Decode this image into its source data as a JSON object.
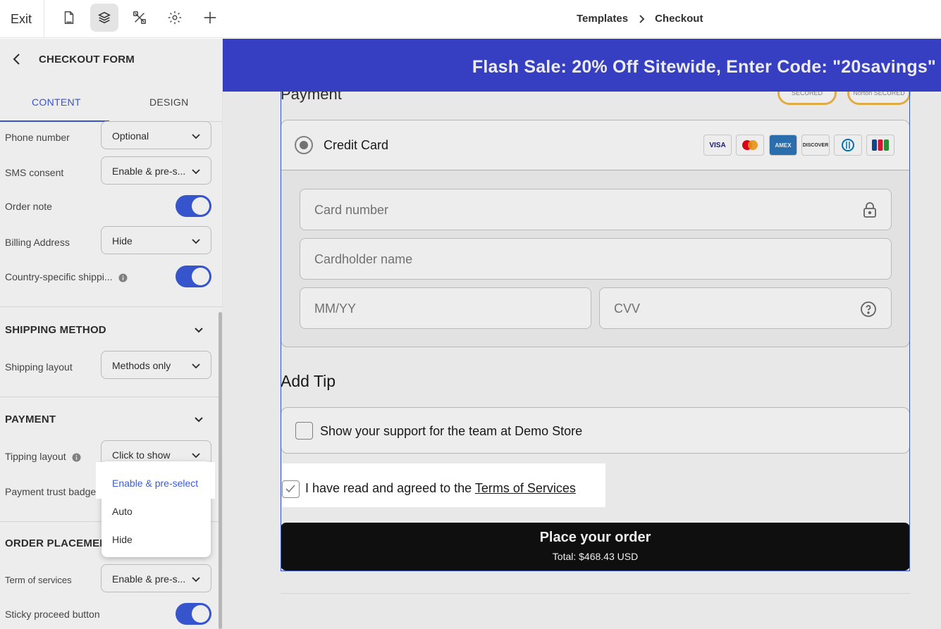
{
  "topbar": {
    "exit_label": "Exit",
    "icons": [
      "page-icon",
      "layers-icon",
      "tools-icon",
      "settings-icon",
      "add-icon"
    ],
    "breadcrumb": [
      "Templates",
      "Checkout"
    ]
  },
  "sidebar": {
    "title": "CHECKOUT FORM",
    "tabs": [
      "CONTENT",
      "DESIGN"
    ],
    "fields": {
      "phone": {
        "label": "Phone number",
        "value": "Optional"
      },
      "sms": {
        "label": "SMS consent",
        "value": "Enable & pre-s..."
      },
      "order_note": {
        "label": "Order note",
        "on": true
      },
      "billing": {
        "label": "Billing Address",
        "value": "Hide"
      },
      "country": {
        "label": "Country-specific shippi...",
        "on": true
      }
    },
    "shipping": {
      "title": "SHIPPING METHOD",
      "layout_label": "Shipping layout",
      "layout_value": "Methods only"
    },
    "payment": {
      "title": "PAYMENT",
      "tipping_label": "Tipping layout",
      "tipping_value": "Click to show",
      "trust_label": "Payment trust badges"
    },
    "order_placement": {
      "title": "ORDER PLACEMENT",
      "terms_label": "Term of services",
      "terms_value": "Enable & pre-s...",
      "sticky_label": "Sticky proceed button"
    },
    "dropdown_options": [
      "Enable & pre-select",
      "Auto",
      "Hide"
    ]
  },
  "preview": {
    "banner": "Flash Sale: 20% Off Sitewide, Enter Code: \"20savings\"",
    "payment_title": "Payment",
    "badge_secured_1": "SECURED",
    "badge_secured_2": "Norton SECURED",
    "credit_card_label": "Credit Card",
    "card_logos": [
      "VISA",
      "MC",
      "AMEX",
      "DISCOVER",
      "DINERS",
      "JCB"
    ],
    "card_number_placeholder": "Card number",
    "cardholder_placeholder": "Cardholder name",
    "expiry_placeholder": "MM/YY",
    "cvv_placeholder": "CVV",
    "tip_title": "Add Tip",
    "tip_label": "Show your support for the team at Demo Store",
    "terms_prefix": "I have read and agreed to the ",
    "terms_link": "Terms of Services",
    "order_button": "Place your order",
    "order_total": "Total: $468.43 USD"
  }
}
